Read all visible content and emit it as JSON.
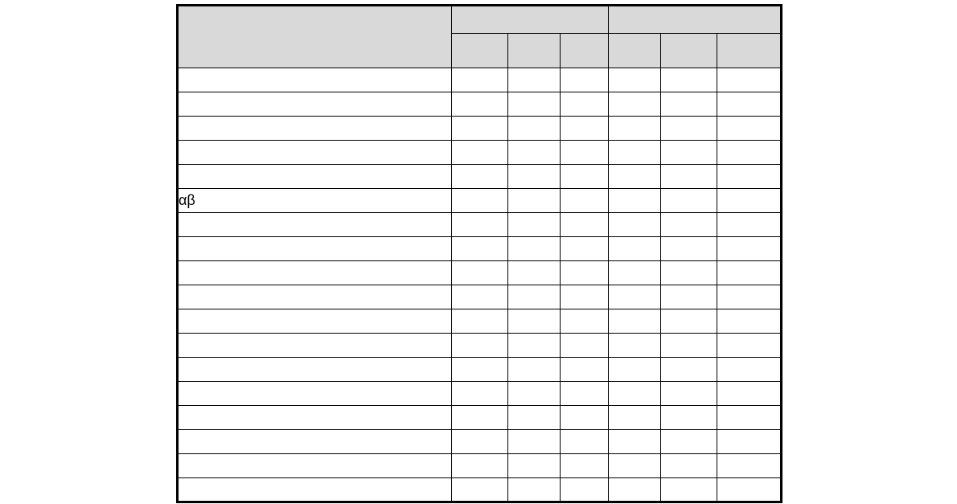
{
  "table": {
    "header": {
      "rowLabel": "",
      "group1": {
        "title": "",
        "sub": [
          "",
          "",
          ""
        ]
      },
      "group2": {
        "title": "",
        "sub": [
          "",
          "",
          ""
        ]
      }
    },
    "rows": [
      {
        "label": "",
        "g1": [
          "",
          "",
          ""
        ],
        "g2": [
          "",
          "",
          ""
        ]
      },
      {
        "label": "",
        "g1": [
          "",
          "",
          ""
        ],
        "g2": [
          "",
          "",
          ""
        ]
      },
      {
        "label": "",
        "g1": [
          "",
          "",
          ""
        ],
        "g2": [
          "",
          "",
          ""
        ]
      },
      {
        "label": "",
        "g1": [
          "",
          "",
          ""
        ],
        "g2": [
          "",
          "",
          ""
        ]
      },
      {
        "label": "",
        "g1": [
          "",
          "",
          ""
        ],
        "g2": [
          "",
          "",
          ""
        ]
      },
      {
        "label": "αβ",
        "g1": [
          "",
          "",
          ""
        ],
        "g2": [
          "",
          "",
          ""
        ]
      },
      {
        "label": "",
        "g1": [
          "",
          "",
          ""
        ],
        "g2": [
          "",
          "",
          ""
        ]
      },
      {
        "label": "",
        "g1": [
          "",
          "",
          ""
        ],
        "g2": [
          "",
          "",
          ""
        ]
      },
      {
        "label": "",
        "g1": [
          "",
          "",
          ""
        ],
        "g2": [
          "",
          "",
          ""
        ]
      },
      {
        "label": "",
        "g1": [
          "",
          "",
          ""
        ],
        "g2": [
          "",
          "",
          ""
        ]
      },
      {
        "label": "",
        "g1": [
          "",
          "",
          ""
        ],
        "g2": [
          "",
          "",
          ""
        ]
      },
      {
        "label": "",
        "g1": [
          "",
          "",
          ""
        ],
        "g2": [
          "",
          "",
          ""
        ]
      },
      {
        "label": "",
        "g1": [
          "",
          "",
          ""
        ],
        "g2": [
          "",
          "",
          ""
        ]
      },
      {
        "label": "",
        "g1": [
          "",
          "",
          ""
        ],
        "g2": [
          "",
          "",
          ""
        ]
      },
      {
        "label": "",
        "g1": [
          "",
          "",
          ""
        ],
        "g2": [
          "",
          "",
          ""
        ]
      },
      {
        "label": "",
        "g1": [
          "",
          "",
          ""
        ],
        "g2": [
          "",
          "",
          ""
        ]
      },
      {
        "label": "",
        "g1": [
          "",
          "",
          ""
        ],
        "g2": [
          "",
          "",
          ""
        ]
      },
      {
        "label": "",
        "g1": [
          "",
          "",
          ""
        ],
        "g2": [
          "",
          "",
          ""
        ]
      }
    ]
  }
}
